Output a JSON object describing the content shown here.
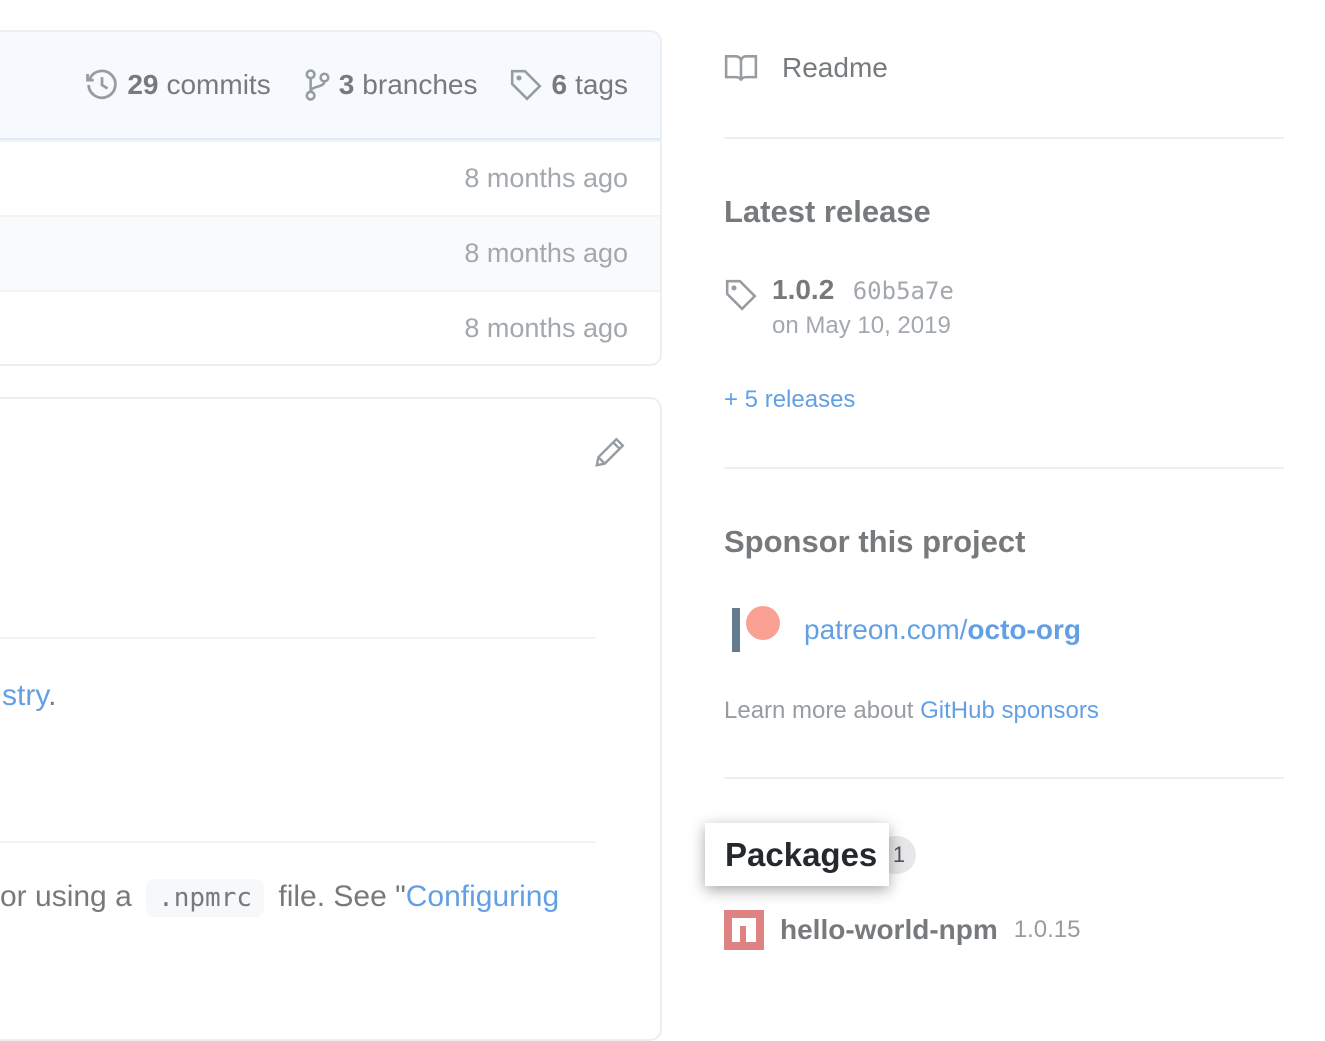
{
  "repo_summary": {
    "commits": {
      "count": "29",
      "label": "commits",
      "icon": "history-icon"
    },
    "branches": {
      "count": "3",
      "label": "branches",
      "icon": "git-branch-icon"
    },
    "tags": {
      "count": "6",
      "label": "tags",
      "icon": "tag-icon"
    }
  },
  "file_rows": [
    {
      "age": "8 months ago"
    },
    {
      "age": "8 months ago"
    },
    {
      "age": "8 months ago"
    }
  ],
  "readme_box": {
    "edit_icon": "pencil-icon",
    "line1": {
      "link_tail": "stry",
      "suffix": "."
    },
    "line2": {
      "prefix": "or using a",
      "code": ".npmrc",
      "middle": "file. See \"",
      "link": "Configuring"
    }
  },
  "sidebar": {
    "readme_label": "Readme",
    "readme_icon": "book-icon",
    "latest_release": {
      "heading": "Latest release",
      "version": "1.0.2",
      "sha": "60b5a7e",
      "date": "on May 10, 2019",
      "more_link": "+ 5 releases"
    },
    "sponsor": {
      "heading": "Sponsor this project",
      "patreon_prefix": "patreon.com/",
      "patreon_user": "octo-org",
      "learn_text": "Learn more about ",
      "learn_link": "GitHub sponsors"
    },
    "packages": {
      "heading": "Packages",
      "count": "1",
      "items": [
        {
          "name": "hello-world-npm",
          "version": "1.0.15",
          "icon": "npm-icon"
        }
      ]
    }
  },
  "colors": {
    "link": "#0366d6",
    "summary_bg": "#f1f8ff",
    "text": "#24292e",
    "muted": "#6a737d",
    "patreon": "#f96854",
    "npm": "#cb3837"
  }
}
